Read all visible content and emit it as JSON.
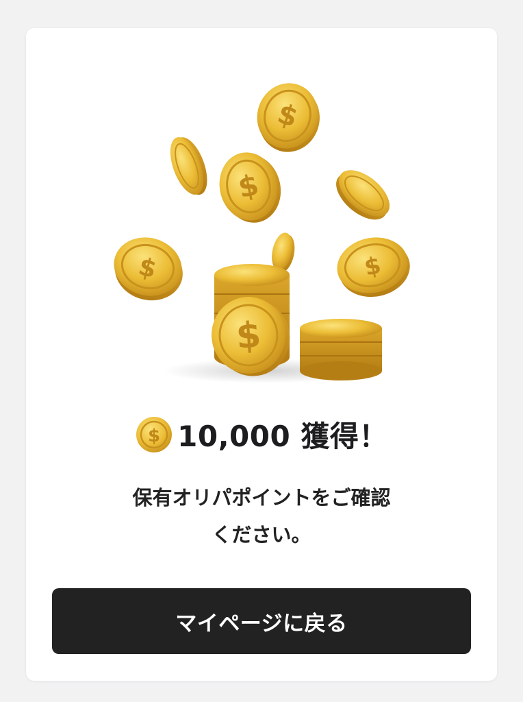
{
  "reward": {
    "icon": "coin-icon",
    "amount": "10,000",
    "suffix": "獲得！"
  },
  "message": {
    "line1": "保有オリパポイントをご確認",
    "line2": "ください。"
  },
  "button": {
    "label": "マイページに戻る"
  },
  "illustration": {
    "icon": "falling-coins-illustration"
  },
  "colors": {
    "background": "#f2f2f3",
    "card": "#ffffff",
    "button": "#222222",
    "button_text": "#ffffff",
    "coin_gold": "#e9b830",
    "text": "#1d1d1f"
  }
}
